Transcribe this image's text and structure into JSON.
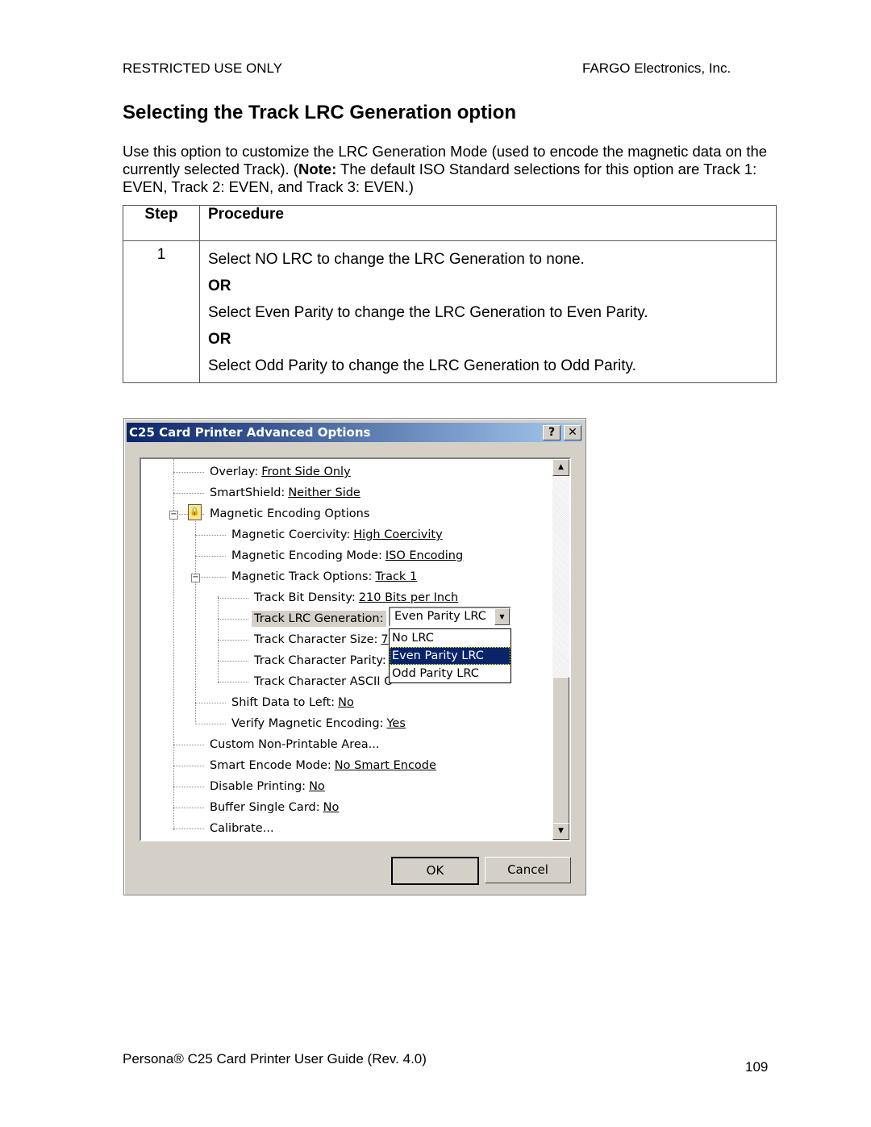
{
  "header": {
    "left": "RESTRICTED USE ONLY",
    "right": "FARGO Electronics, Inc."
  },
  "title": "Selecting the Track LRC Generation option",
  "intro": {
    "text1": "Use this option to customize the LRC Generation Mode (used to encode the magnetic data on the currently selected Track).  (",
    "note": "Note:",
    "text2": "  The default ISO Standard selections for this option are Track 1: EVEN, Track 2: EVEN, and Track 3: EVEN.)"
  },
  "table": {
    "headers": [
      "Step",
      "Procedure"
    ],
    "step": "1",
    "lines": [
      "Select NO LRC to change the LRC Generation to none.",
      "OR",
      "Select Even Parity to change the LRC Generation to Even Parity.",
      "OR",
      "Select Odd Parity to change the LRC Generation to Odd Parity."
    ]
  },
  "dialog": {
    "title": "C25 Card Printer Advanced Options",
    "help": "?",
    "close": "✕",
    "tree": [
      {
        "label": "Overlay:",
        "value": "Front Side Only"
      },
      {
        "label": "SmartShield:",
        "value": "Neither Side"
      },
      {
        "label": "Magnetic Encoding Options",
        "value": ""
      },
      {
        "label": "Magnetic Coercivity:",
        "value": "High Coercivity"
      },
      {
        "label": "Magnetic Encoding Mode:",
        "value": "ISO Encoding"
      },
      {
        "label": "Magnetic Track Options:",
        "value": "Track 1"
      },
      {
        "label": "Track Bit Density:",
        "value": "210 Bits per Inch"
      },
      {
        "label": "Track LRC Generation:",
        "value": ""
      },
      {
        "label": "Track Character Size:",
        "value": "7"
      },
      {
        "label": "Track Character Parity:",
        "value": ""
      },
      {
        "label": "Track Character ASCII O",
        "value": ""
      },
      {
        "label": "Shift Data to Left:",
        "value": "No"
      },
      {
        "label": "Verify Magnetic Encoding:",
        "value": "Yes"
      },
      {
        "label": "Custom Non-Printable Area...",
        "value": ""
      },
      {
        "label": "Smart Encode Mode:",
        "value": "No Smart Encode"
      },
      {
        "label": "Disable Printing:",
        "value": "No"
      },
      {
        "label": "Buffer Single Card:",
        "value": "No"
      },
      {
        "label": "Calibrate...",
        "value": ""
      }
    ],
    "combo": {
      "selected": "Even Parity LRC",
      "options": [
        "No LRC",
        "Even Parity LRC",
        "Odd Parity LRC"
      ]
    },
    "ok": "OK",
    "cancel": "Cancel",
    "highlight": "#0a246a"
  },
  "footer": {
    "guide": "Persona® C25 Card Printer User Guide (Rev. 4.0)",
    "page": "109"
  }
}
